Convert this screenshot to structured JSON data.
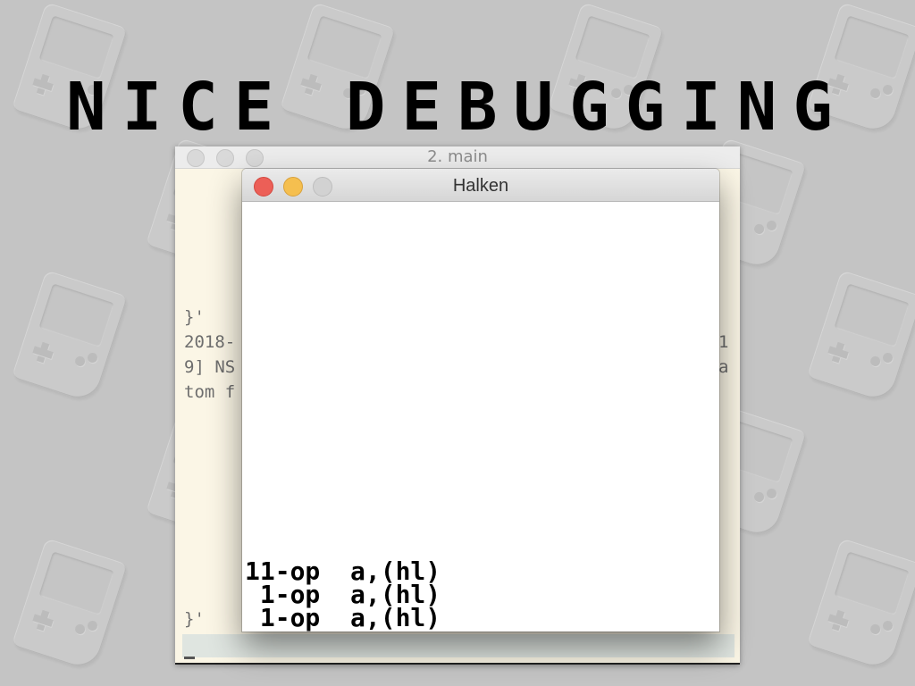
{
  "banner": {
    "title": "NICE DEBUGGING"
  },
  "back_window": {
    "title": "2. main",
    "lines": [
      "}'",
      "2018-",
      "9] NS",
      "tom f",
      "}'"
    ],
    "right_fragments": [
      "1",
      "a"
    ]
  },
  "front_window": {
    "title": "Halken",
    "output": [
      "11-op  a,(hl)",
      " 1-op  a,(hl)",
      " 1-op  a,(hl)"
    ]
  },
  "watermark": {
    "icon": "gameboy-icon"
  }
}
